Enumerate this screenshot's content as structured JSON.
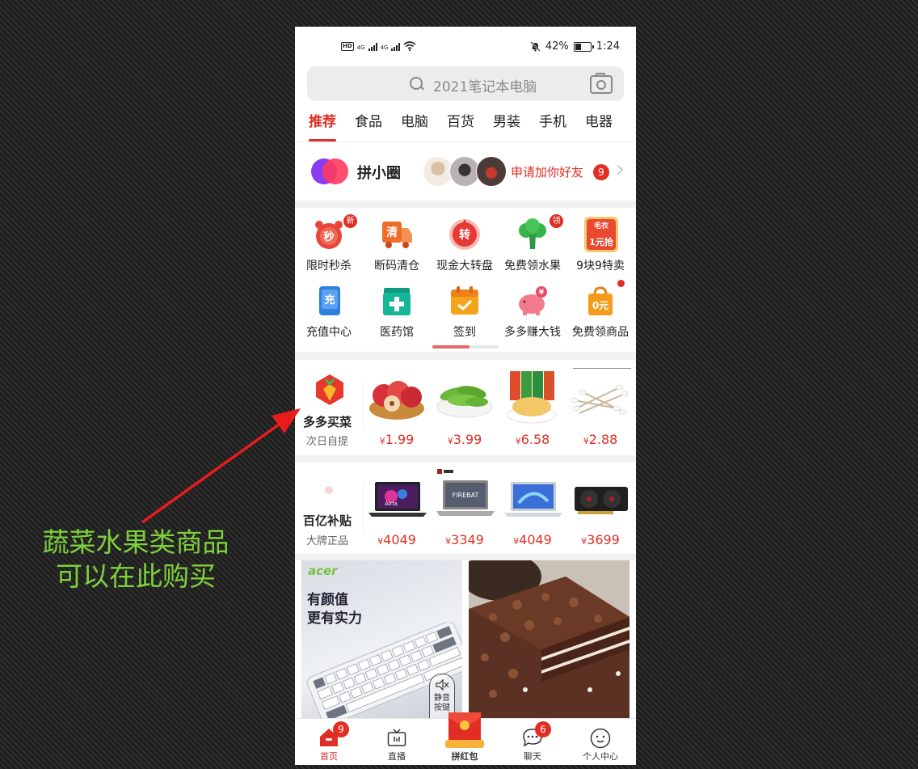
{
  "status_bar": {
    "network": "HD",
    "signal1": "4G",
    "signal2": "4G",
    "battery": "42%",
    "time": "1:24"
  },
  "search": {
    "placeholder": "2021笔记本电脑"
  },
  "tabs": [
    {
      "label": "推荐",
      "active": true
    },
    {
      "label": "食品"
    },
    {
      "label": "电脑"
    },
    {
      "label": "百货"
    },
    {
      "label": "男装"
    },
    {
      "label": "手机"
    },
    {
      "label": "电器"
    }
  ],
  "circle": {
    "title": "拼小圈",
    "friend_request": "申请加你好友",
    "badge": "9"
  },
  "grid": [
    {
      "label": "限时秒杀",
      "icon": "alarm-clock-icon",
      "glyph": "秒",
      "badge": "新",
      "color": "#e8463b"
    },
    {
      "label": "断码清仓",
      "icon": "clearance-truck-icon",
      "glyph": "清",
      "color": "#f06a28"
    },
    {
      "label": "现金大转盘",
      "icon": "spin-wheel-icon",
      "glyph": "转",
      "color": "#e63a32"
    },
    {
      "label": "免费领水果",
      "icon": "broccoli-icon",
      "badge": "领",
      "color": "#38b24a"
    },
    {
      "label": "9块9特卖",
      "icon": "sweater-sale-icon",
      "glyph": "毛衣",
      "glyph2": "1元抢",
      "color": "#e9492f"
    },
    {
      "label": "充值中心",
      "icon": "phone-recharge-icon",
      "glyph": "充",
      "color": "#2d7fe0"
    },
    {
      "label": "医药馆",
      "icon": "medicine-box-icon",
      "color": "#16b69a"
    },
    {
      "label": "签到",
      "icon": "calendar-check-icon",
      "color": "#f4a31b"
    },
    {
      "label": "多多赚大钱",
      "icon": "piggy-bank-icon",
      "glyph": "¥",
      "color": "#f47b8c"
    },
    {
      "label": "免费领商品",
      "icon": "shopping-bag-icon",
      "glyph": "0元",
      "color": "#f59b1b"
    }
  ],
  "grocery": {
    "title": "多多买菜",
    "subtitle": "次日自提",
    "products": [
      {
        "name": "apples",
        "price": "1.99"
      },
      {
        "name": "edamame",
        "price": "3.99"
      },
      {
        "name": "snacks",
        "price": "6.58"
      },
      {
        "name": "cotton-swabs",
        "price": "2.88"
      }
    ]
  },
  "subsidy": {
    "title": "百亿补贴",
    "subtitle": "大牌正品",
    "products": [
      {
        "name": "laptop-airia",
        "price": "4049"
      },
      {
        "name": "laptop-firebat",
        "price": "3349"
      },
      {
        "name": "laptop-blue",
        "price": "4049"
      },
      {
        "name": "graphics-card",
        "price": "3699"
      }
    ],
    "laptop2_text": "FIREBAT",
    "laptop1_text": "Airia"
  },
  "banners": [
    {
      "brand": "acer",
      "line1": "有颜值",
      "line2": "更有实力",
      "button_line1": "静音",
      "button_line2": "按键"
    },
    {
      "name": "chocolate-cake"
    }
  ],
  "bottom_nav": [
    {
      "label": "首页",
      "icon": "home-icon",
      "badge": "9",
      "active": true
    },
    {
      "label": "直播",
      "icon": "tv-icon"
    },
    {
      "label": "拼红包",
      "icon": "red-envelope-icon"
    },
    {
      "label": "聊天",
      "icon": "chat-icon",
      "badge": "6"
    },
    {
      "label": "个人中心",
      "icon": "profile-icon"
    }
  ],
  "currency": "¥",
  "annotation": {
    "line1": "蔬菜水果类商品",
    "line2": "可以在此购买",
    "color": "#7fd13b",
    "arrow_color": "#e81c1c"
  }
}
